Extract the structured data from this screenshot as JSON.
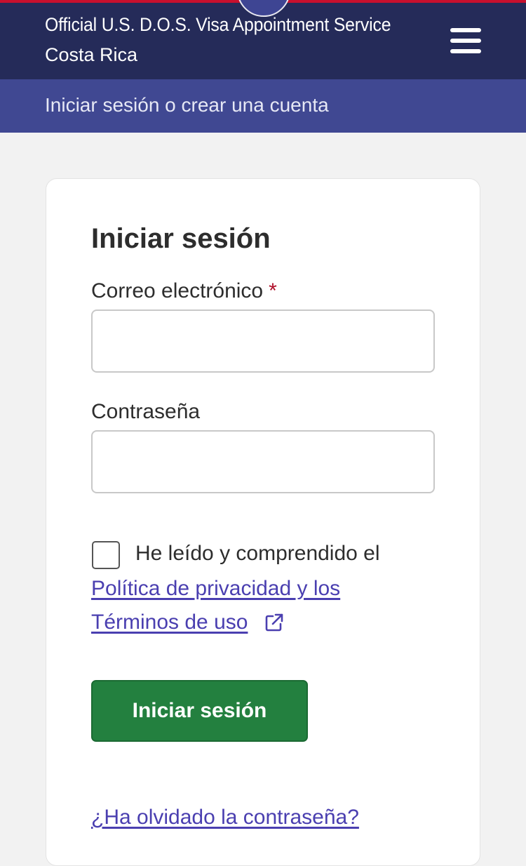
{
  "header": {
    "title_line1": "Official U.S. D.O.S. Visa Appointment Service",
    "title_line2": "Costa Rica",
    "menu_icon": "hamburger-menu-icon"
  },
  "subheader": {
    "text": "Iniciar sesión o crear una cuenta"
  },
  "login": {
    "heading": "Iniciar sesión",
    "email_label": "Correo electrónico",
    "required_marker": "*",
    "email_value": "",
    "password_label": "Contraseña",
    "password_value": "",
    "consent_text": "He leído y comprendido el",
    "policy_link_line1": "Política de privacidad y los",
    "policy_link_line2": "Términos de uso",
    "external_link_icon": "external-link-icon",
    "submit_label": "Iniciar sesión",
    "forgot_password_link": "¿Ha olvidado la contraseña?"
  },
  "colors": {
    "header_bg": "#252b59",
    "subheader_bg": "#404892",
    "accent_red": "#c8102e",
    "button_green": "#23803f",
    "link_purple": "#4a3fb0"
  }
}
